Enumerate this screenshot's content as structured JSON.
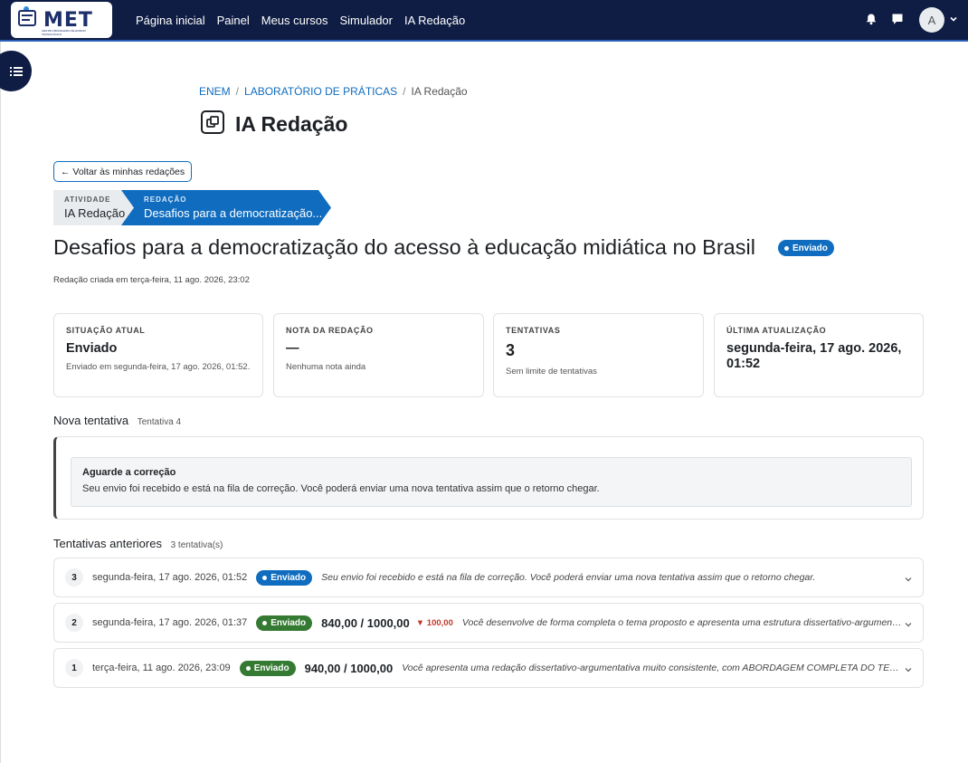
{
  "header": {
    "logo_text": "MET",
    "logo_sub": "CENTRO BRASILEIRO DE ENSINO TECNOLÓGICO",
    "nav": [
      "Página inicial",
      "Painel",
      "Meus cursos",
      "Simulador",
      "IA Redação"
    ],
    "avatar_initial": "A"
  },
  "breadcrumb": {
    "items": [
      "ENEM",
      "LABORATÓRIO DE PRÁTICAS",
      "IA Redação"
    ],
    "sep": "/"
  },
  "page": {
    "title": "IA Redação"
  },
  "back_button": "← Voltar às minhas redações",
  "steps": [
    {
      "label": "ATIVIDADE",
      "value": "IA Redação"
    },
    {
      "label": "REDAÇÃO",
      "value": "Desafios para a democratização..."
    }
  ],
  "essay": {
    "title": "Desafios para a democratização do acesso à educação midiática no Brasil",
    "status": "Enviado",
    "created": "Redação criada em terça-feira, 11 ago. 2026, 23:02"
  },
  "cards": [
    {
      "label": "SITUAÇÃO ATUAL",
      "value": "Enviado",
      "sub": "Enviado em segunda-feira, 17 ago. 2026, 01:52."
    },
    {
      "label": "NOTA DA REDAÇÃO",
      "value": "—",
      "sub": "Nenhuma nota ainda"
    },
    {
      "label": "TENTATIVAS",
      "value": "3",
      "sub": "Sem limite de tentativas"
    },
    {
      "label": "ÚLTIMA ATUALIZAÇÃO",
      "value": "segunda-feira, 17 ago. 2026, 01:52",
      "sub": ""
    }
  ],
  "new_attempt": {
    "heading": "Nova tentativa",
    "tag": "Tentativa 4",
    "alert_title": "Aguarde a correção",
    "alert_body": "Seu envio foi recebido e está na fila de correção. Você poderá enviar uma nova tentativa assim que o retorno chegar."
  },
  "previous": {
    "heading": "Tentativas anteriores",
    "count": "3 tentativa(s)",
    "rows": [
      {
        "num": "3",
        "date": "segunda-feira, 17 ago. 2026, 01:52",
        "status": "Enviado",
        "status_color": "#0f6cbf",
        "score": "",
        "delta": "",
        "message": "Seu envio foi recebido e está na fila de correção. Você poderá enviar uma nova tentativa assim que o retorno chegar."
      },
      {
        "num": "2",
        "date": "segunda-feira, 17 ago. 2026, 01:37",
        "status": "Enviado",
        "status_color": "#357a32",
        "score": "840,00 / 1000,00",
        "delta": "▼ 100,00",
        "message": "Você desenvolve de forma completa o tema proposto e apresenta uma estrutura dissertativo-argumentativa bem definida..."
      },
      {
        "num": "1",
        "date": "terça-feira, 11 ago. 2026, 23:09",
        "status": "Enviado",
        "status_color": "#357a32",
        "score": "940,00 / 1000,00",
        "delta": "",
        "message": "Você apresenta uma redação dissertativo-argumentativa muito consistente, com ABORDAGEM COMPLETA DO TEMA..."
      }
    ]
  },
  "colors": {
    "topbar": "#0f1d44",
    "primary": "#0f6cbf",
    "success": "#357a32",
    "danger": "#c0392b"
  },
  "icons": {
    "bell": "bell-icon",
    "chat": "chat-icon",
    "drawer": "list-icon",
    "chevron": "chevron-down-icon",
    "page": "activity-icon"
  }
}
